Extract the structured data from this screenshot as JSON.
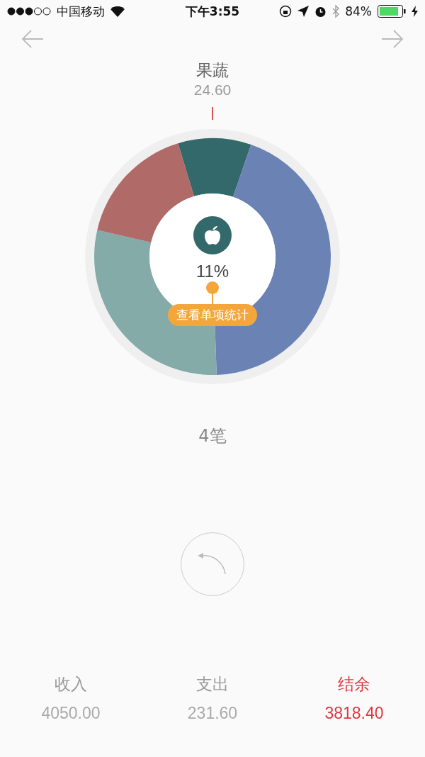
{
  "status_bar": {
    "carrier": "中国移动",
    "time": "下午3:55",
    "battery": "84%"
  },
  "category": {
    "name": "果蔬",
    "amount": "24.60",
    "percent": "11%",
    "button": "查看单项统计"
  },
  "count": "4笔",
  "totals": [
    {
      "label": "收入",
      "value": "4050.00",
      "highlight": false
    },
    {
      "label": "支出",
      "value": "231.60",
      "highlight": false
    },
    {
      "label": "结余",
      "value": "3818.40",
      "highlight": true
    }
  ]
}
